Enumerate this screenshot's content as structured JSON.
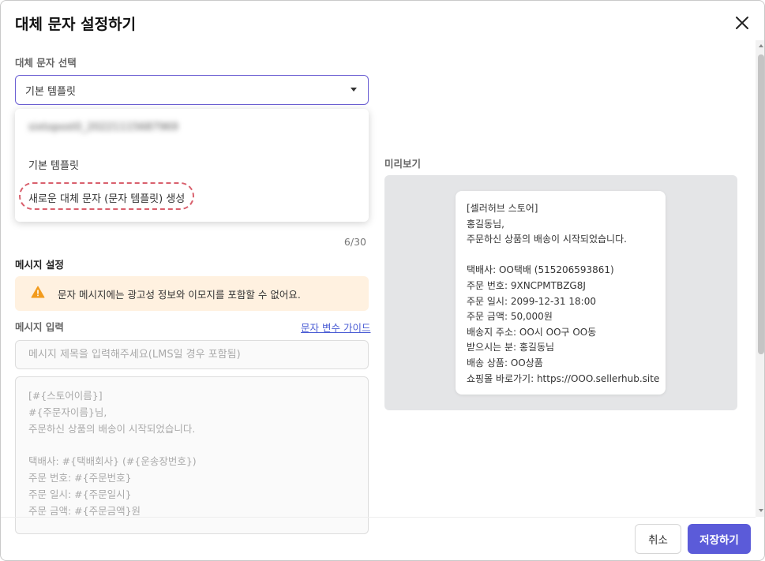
{
  "dialog": {
    "title": "대체 문자 설정하기"
  },
  "template_select": {
    "label": "대체 문자 선택",
    "selected": "기본 템플릿",
    "options": [
      "sixtopost0_20221115687969",
      "기본 템플릿",
      "새로운 대체 문자 (문자 템플릿) 생성"
    ]
  },
  "char_count": "6/30",
  "message_settings": {
    "label": "메시지 설정",
    "warning": "문자 메시지에는 광고성 정보와 이모지를 포함할 수 없어요."
  },
  "message_input": {
    "label": "메시지 입력",
    "guide_link": "문자 변수 가이드",
    "subject_placeholder": "메시지 제목을 입력해주세요(LMS일 경우 포함됨)",
    "body_lines": [
      "[#{스토어이름}]",
      "#{주문자이름}님,",
      "주문하신 상품의 배송이 시작되었습니다.",
      "",
      "택배사: #{택배회사} (#{운송장번호})",
      "주문 번호: #{주문번호}",
      "주문 일시: #{주문일시}",
      "주문 금액: #{주문금액}원"
    ]
  },
  "preview": {
    "label": "미리보기",
    "lines": [
      "[셀러허브 스토어]",
      "홍길동님,",
      "주문하신 상품의 배송이 시작되었습니다.",
      "",
      "택배사: OO택배 (515206593861)",
      "주문 번호: 9XNCPMTBZG8J",
      "주문 일시: 2099-12-31 18:00",
      "주문 금액: 50,000원",
      "배송지 주소: OO시 OO구 OO동",
      "받으시는 분: 홍길동님",
      "배송 상품: OO상품",
      "쇼핑몰 바로가기: https://OOO.sellerhub.site"
    ]
  },
  "footer": {
    "cancel": "취소",
    "save": "저장하기"
  },
  "colors": {
    "primary": "#5b5bd9",
    "warning_bg": "#fff1e0",
    "warning_icon": "#f29b1d",
    "highlight": "#d9606d"
  }
}
